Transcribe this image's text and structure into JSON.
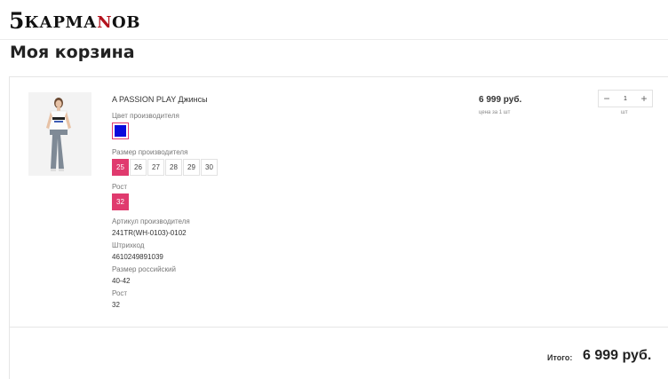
{
  "logo": {
    "five": "5",
    "word_pre": "КАРМА",
    "word_accent": "N",
    "word_post": "ОВ"
  },
  "page": {
    "title": "Моя корзина"
  },
  "item": {
    "name": "A PASSION PLAY Джинсы",
    "color_label": "Цвет производителя",
    "color_value": "#0a0adb",
    "size_label": "Размер производителя",
    "sizes": [
      "25",
      "26",
      "27",
      "28",
      "29",
      "30"
    ],
    "selected_size": "25",
    "height_label": "Рост",
    "height_option": "32",
    "article_label": "Артикул производителя",
    "article": "241TR(WH-0103)-0102",
    "barcode_label": "Штрихкод",
    "barcode": "4610249891039",
    "ru_size_label": "Размер российский",
    "ru_size": "40-42",
    "height2_label": "Рост",
    "height2": "32",
    "price": "6 999 руб.",
    "price_note": "цена за 1 шт",
    "qty_minus": "−",
    "qty_value": "1",
    "qty_plus": "+",
    "qty_unit": "шт"
  },
  "summary": {
    "total_label": "Итого:",
    "total_value": "6 999 руб."
  },
  "colors": {
    "accent": "#e03a6e",
    "brand_red": "#b3121d"
  }
}
